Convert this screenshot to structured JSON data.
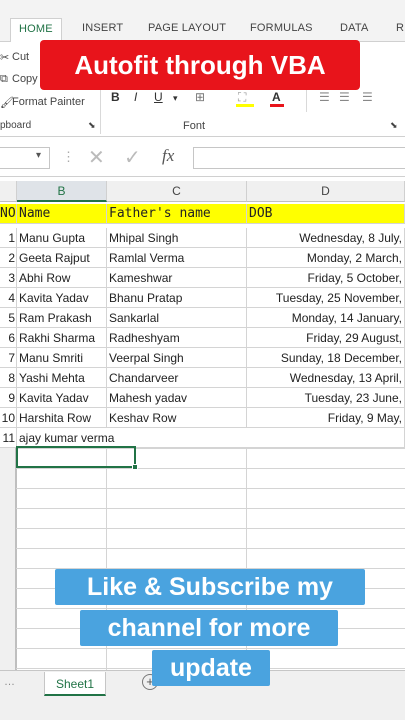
{
  "ribbon": {
    "tabs": [
      "HOME",
      "INSERT",
      "PAGE LAYOUT",
      "FORMULAS",
      "DATA",
      "RE"
    ],
    "active_tab": "HOME",
    "cut": "Cut",
    "copy": "Copy",
    "format_painter": "Format Painter",
    "clipboard_group": "pboard",
    "font_group": "Font",
    "bold": "B",
    "italic": "I",
    "underline": "U"
  },
  "formula_bar": {
    "fx": "fx"
  },
  "columns": [
    "B",
    "C",
    "D"
  ],
  "rows": [
    "1",
    "2",
    "3",
    "4",
    "5",
    "6",
    "7",
    "8",
    "9",
    "10",
    "11"
  ],
  "table": {
    "headers": [
      "NO",
      "Name",
      "Father's name",
      "DOB"
    ],
    "records": [
      {
        "no": "1",
        "name": "Manu Gupta",
        "father": "Mhipal Singh",
        "dob": "Wednesday, 8 July,"
      },
      {
        "no": "2",
        "name": "Geeta Rajput",
        "father": "Ramlal Verma",
        "dob": "Monday, 2 March,"
      },
      {
        "no": "3",
        "name": "Abhi Row",
        "father": "Kameshwar",
        "dob": "Friday, 5 October,"
      },
      {
        "no": "4",
        "name": "Kavita Yadav",
        "father": "Bhanu Pratap",
        "dob": "Tuesday, 25 November,"
      },
      {
        "no": "5",
        "name": "Ram Prakash",
        "father": "Sankarlal",
        "dob": "Monday, 14 January,"
      },
      {
        "no": "6",
        "name": "Rakhi Sharma",
        "father": "Radheshyam",
        "dob": "Friday, 29 August,"
      },
      {
        "no": "7",
        "name": "Manu Smriti",
        "father": "Veerpal Singh",
        "dob": "Sunday, 18 December,"
      },
      {
        "no": "8",
        "name": "Yashi Mehta",
        "father": "Chandarveer",
        "dob": "Wednesday, 13 April,"
      },
      {
        "no": "9",
        "name": "Kavita Yadav",
        "father": "Mahesh yadav",
        "dob": "Tuesday, 23 June,"
      },
      {
        "no": "10",
        "name": "Harshita Row",
        "father": "Keshav Row",
        "dob": "Friday, 9 May,"
      },
      {
        "no": "11",
        "name": "ajay kumar verma",
        "father": "",
        "dob": ""
      }
    ]
  },
  "sheet_tab": "Sheet1",
  "overlay": {
    "top": "Autofit through VBA",
    "bottom": [
      "Like & Subscribe my",
      "channel for more",
      "update"
    ]
  },
  "colors": {
    "header_fill": "#ffff00",
    "banner_red": "#e8141b",
    "banner_blue": "#4aa3df",
    "excel_green": "#217346"
  }
}
